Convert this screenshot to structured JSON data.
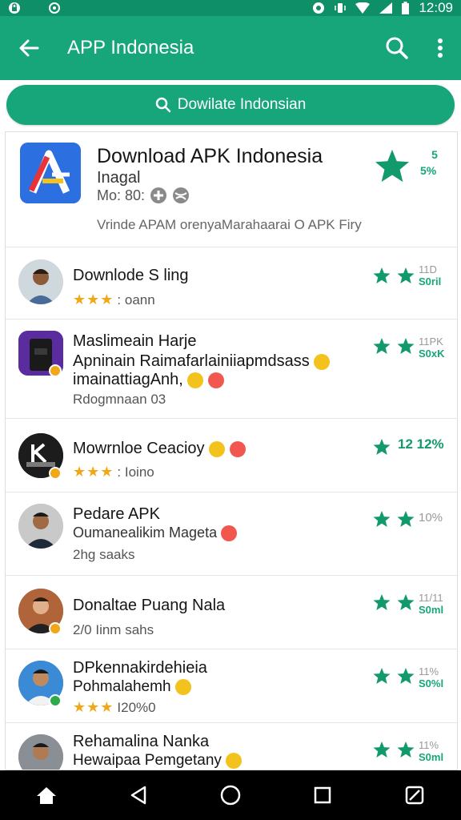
{
  "status_bar": {
    "time": "12:09"
  },
  "app_bar": {
    "title": "APP Indonesia"
  },
  "search": {
    "label": "Dowilate Indonsian"
  },
  "featured": {
    "title": "Download APK Indonesia",
    "subtitle": "Inagal",
    "meta": "Mo: 80:",
    "description": "Vrinde APAM orenyaMarahaarai O APK Firy",
    "rating_num": "5",
    "rating_pct": "5%"
  },
  "items": [
    {
      "name": "Downlode S ling",
      "line2": "",
      "sub": ": oann",
      "stars_visible": true,
      "count_top": "11D",
      "count_bottom": "S0ril"
    },
    {
      "name": "Maslimeain Harje",
      "line2": "Apninain Raimafarlainiiapmdsass",
      "line3": "imainattiagAnh,",
      "sub": "Rdogmnaan 03",
      "stars_visible": false,
      "count_top": "11PK",
      "count_bottom": "S0xK"
    },
    {
      "name": "Mowrnloe Ceacioy",
      "line2": "",
      "sub": ": Ioino",
      "stars_visible": true,
      "count_top": "12 12%",
      "count_bottom": ""
    },
    {
      "name": "Pedare APK",
      "line2": "Oumanealikim Mageta",
      "sub": "2hg    saaks",
      "stars_visible": false,
      "count_top": "10%",
      "count_bottom": ""
    },
    {
      "name": "Donaltae Puang Nala",
      "line2": "",
      "sub": "2/0 Iinm sahs",
      "stars_visible": false,
      "count_top": "11/11",
      "count_bottom": "S0ml"
    },
    {
      "name": "DPkennakirdehieia",
      "line2": "Pohmalahemh",
      "sub": "I20%0",
      "stars_visible": true,
      "count_top": "11%",
      "count_bottom": "S0%l"
    },
    {
      "name": "Rehamalina Nanka",
      "line2": "Hewaipaa Pemgetany",
      "sub": "",
      "stars_visible": false,
      "count_top": "11%",
      "count_bottom": "S0ml"
    }
  ],
  "colors": {
    "primary": "#17a57a",
    "status": "#0f8f67",
    "star_green": "#129a6c",
    "star_gold": "#f0a818"
  }
}
